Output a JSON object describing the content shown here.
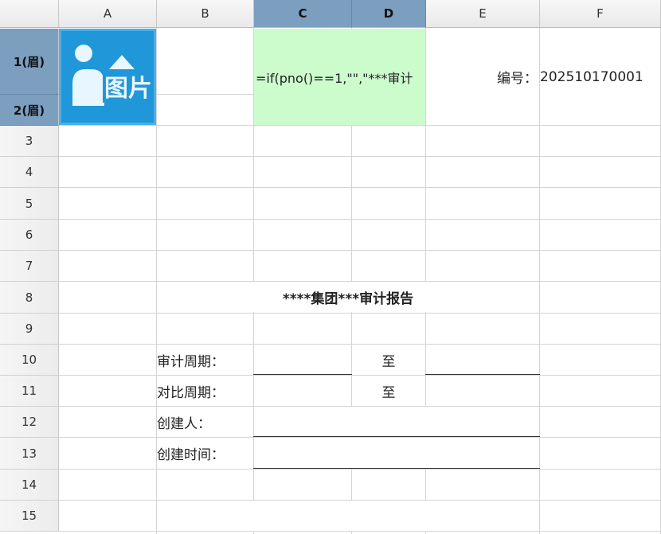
{
  "columns": [
    "A",
    "B",
    "C",
    "D",
    "E",
    "F"
  ],
  "selected_columns": [
    "C",
    "D"
  ],
  "rows": [
    "1(眉)",
    "2(眉)",
    "3",
    "4",
    "5",
    "6",
    "7",
    "8",
    "9",
    "10",
    "11",
    "12",
    "13",
    "14",
    "15"
  ],
  "selected_rows": [
    "1(眉)",
    "2(眉)"
  ],
  "cells": {
    "image_placeholder": "图片",
    "formula": "=if(pno()==1,\"\",\"***审计",
    "serial_label": "编号：",
    "serial_value": "202510170001",
    "report_title": "****集团***审计报告",
    "audit_period_label": "审计周期：",
    "audit_period_to": "至",
    "compare_period_label": "对比周期：",
    "compare_period_to": "至",
    "creator_label": "创建人：",
    "create_time_label": "创建时间："
  },
  "colors": {
    "selected_header": "#7c9ebf",
    "formula_cell_bg": "#ccfccc",
    "image_bg": "#1f97d8"
  }
}
